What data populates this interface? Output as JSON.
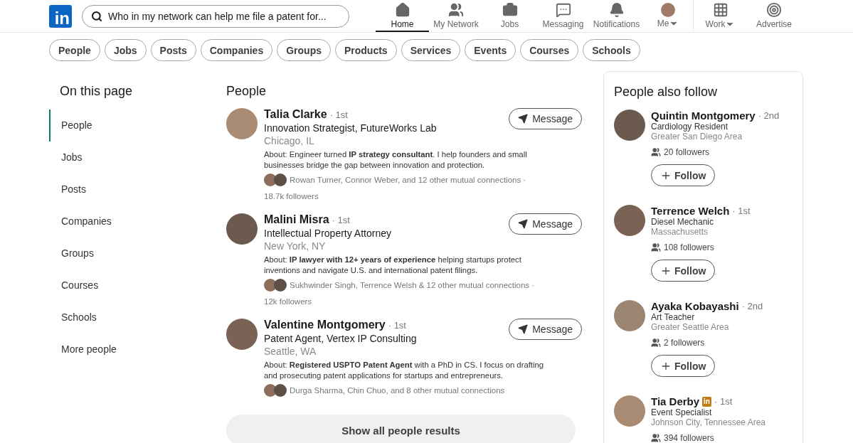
{
  "logo": "in",
  "search": {
    "value": "Who in my network can help me file a patent for..."
  },
  "nav": [
    {
      "kind": "home",
      "label": "Home",
      "selected": true
    },
    {
      "kind": "network",
      "label": "My Network",
      "selected": false
    },
    {
      "kind": "jobs",
      "label": "Jobs",
      "selected": false
    },
    {
      "kind": "messaging",
      "label": "Messaging",
      "selected": false
    },
    {
      "kind": "notifications",
      "label": "Notifications",
      "selected": false
    },
    {
      "kind": "me",
      "label": "Me",
      "selected": false
    },
    {
      "kind": "work",
      "label": "Work",
      "selected": false
    },
    {
      "kind": "advertise",
      "label": "Advertise",
      "selected": false
    }
  ],
  "filters": [
    "People",
    "Jobs",
    "Posts",
    "Companies",
    "Groups",
    "Products",
    "Services",
    "Events",
    "Courses",
    "Schools"
  ],
  "on_this_page": {
    "title": "On this page",
    "items": [
      {
        "label": "People",
        "selected": true
      },
      {
        "label": "Jobs",
        "selected": false
      },
      {
        "label": "Posts",
        "selected": false
      },
      {
        "label": "Companies",
        "selected": false
      },
      {
        "label": "Groups",
        "selected": false
      },
      {
        "label": "Courses",
        "selected": false
      },
      {
        "label": "Schools",
        "selected": false
      },
      {
        "label": "More people",
        "selected": false
      }
    ]
  },
  "people": {
    "title": "People",
    "results": [
      {
        "name": "Talia Clarke",
        "degree": "· 1st",
        "headline": "Innovation Strategist, FutureWorks Lab",
        "location": "Chicago, IL",
        "button": "Message",
        "about": "About: Engineer turned **IP strategy consultant**. I help founders and small businesses bridge the gap between innovation and protection.",
        "mutual": "Rowan Turner, Connor Weber, and 12 other mutual connections ·",
        "followers": "18.7k followers"
      },
      {
        "name": "Malini Misra",
        "degree": "· 1st",
        "headline": "Intellectual Property Attorney",
        "location": "New York, NY",
        "button": "Message",
        "about": "About: **IP lawyer with 12+ years of experience** helping startups protect inventions and navigate U.S. and international patent filings.",
        "mutual": "Sukhwinder Singh, Terrence Welsh & 12 other mutual connections ·",
        "followers": "12k followers"
      },
      {
        "name": "Valentine Montgomery",
        "degree": "· 1st",
        "headline": "Patent Agent, Vertex IP Consulting",
        "location": "Seattle, WA",
        "button": "Message",
        "about": "About: **Registered USPTO Patent Agent** with a PhD in CS. I focus on drafting and prosecuting patent applications for startups and entrepreneurs.",
        "mutual": "Durga Sharma, Chin Chuo, and 8 other mutual connections"
      }
    ],
    "show_all": "Show all people results"
  },
  "also_follow": {
    "title": "People also follow",
    "people": [
      {
        "name": "Quintin Montgomery",
        "degree": "· 2nd",
        "headline": "Cardiology Resident",
        "location": "Greater San Diego Area",
        "button": "Follow",
        "followers": "20 followers"
      },
      {
        "name": "Terrence Welch",
        "degree": "· 1st",
        "headline": "Diesel Mechanic",
        "location": "Massachusetts",
        "button": "Follow",
        "followers": "108 followers"
      },
      {
        "name": "Ayaka Kobayashi",
        "degree": "· 2nd",
        "headline": "Art Teacher",
        "location": "Greater Seattle Area",
        "button": "Follow",
        "followers": "2 followers"
      },
      {
        "name": "Tia Derby",
        "badge": "in",
        "degree": "· 1st",
        "headline": "Event Specialist",
        "location": "Johnson City, Tennessee Area",
        "followers": "394 followers"
      }
    ]
  }
}
